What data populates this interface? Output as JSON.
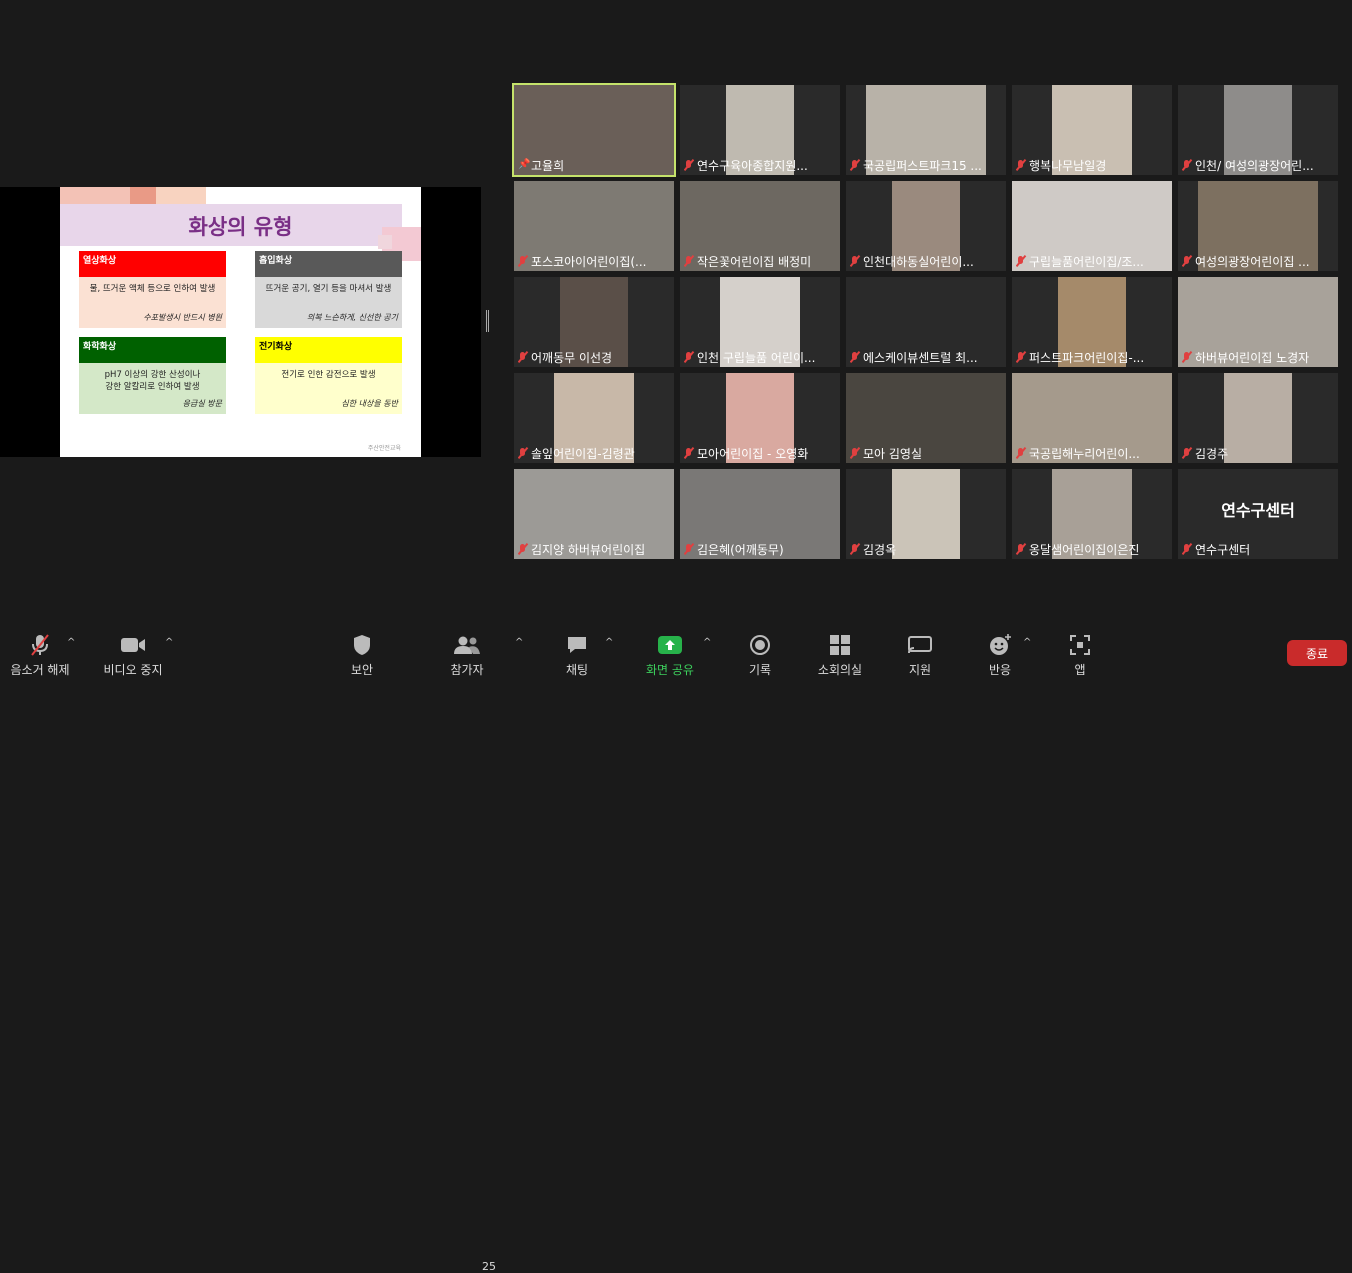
{
  "slide": {
    "title": "화상의 유형",
    "boxes": [
      {
        "header": "열상화상",
        "line1": "물, 뜨거운 액체 등으로 인하여 발생",
        "line2": "",
        "foot": "수포발생시 반드시 병원"
      },
      {
        "header": "흡입화상",
        "line1": "뜨거운 공기, 열기 등을 마셔서 발생",
        "line2": "",
        "foot": "의복 느슨하게, 신선한 공기"
      },
      {
        "header": "화학화상",
        "line1": "pH7 이상의 강한 산성이나",
        "line2": "강한 알칼리로 인하여 발생",
        "foot": "응급실 방문"
      },
      {
        "header": "전기화상",
        "line1": "전기로 인한 감전으로 발생",
        "line2": "",
        "foot": "심한 내상을 동반"
      }
    ],
    "footer": "주산안전교육"
  },
  "participants": [
    {
      "name": "고율희",
      "icon": "pin",
      "video": "#6a5f58",
      "active": true
    },
    {
      "name": "연수구육아종합지원...",
      "icon": "mic-off",
      "video": "#bfbab0"
    },
    {
      "name": "국공립퍼스트파크15 ...",
      "icon": "mic-off",
      "video": "#b8b2a8"
    },
    {
      "name": "행복나무남일경",
      "icon": "mic-off",
      "video": "#c9bfb2"
    },
    {
      "name": "인천/ 여성의광장어린...",
      "icon": "mic-off",
      "video": "#8e8c8a"
    },
    {
      "name": "포스코아이어린이집(...",
      "icon": "mic-off",
      "video": "#7e7a73"
    },
    {
      "name": "작은꽃어린이집 배정미",
      "icon": "mic-off",
      "video": "#6d6861"
    },
    {
      "name": "인천대하동실어린이...",
      "icon": "mic-off",
      "video": "#9a8a7e"
    },
    {
      "name": "구립늘품어린이집/조...",
      "icon": "mic-off",
      "video": "#cfcac6"
    },
    {
      "name": "여성의광장어린이집 ...",
      "icon": "mic-off",
      "video": "#7d7060"
    },
    {
      "name": "어깨동무 이선경",
      "icon": "mic-off",
      "video": "#5a4f48"
    },
    {
      "name": "인천 구립늘품 어린이...",
      "icon": "mic-off",
      "video": "#d5d0cb"
    },
    {
      "name": "에스케이뷰센트럴 최...",
      "icon": "mic-off",
      "video": "#2a2a2a"
    },
    {
      "name": "퍼스트파크어린이집-...",
      "icon": "mic-off",
      "video": "#a58a6a"
    },
    {
      "name": "하버뷰어린이집 노경자",
      "icon": "mic-off",
      "video": "#a8a29a"
    },
    {
      "name": "솔잎어린이집-김령관",
      "icon": "mic-off",
      "video": "#c8b8a8"
    },
    {
      "name": "모아어린이집 - 오영화",
      "icon": "mic-off",
      "video": "#d9a9a0"
    },
    {
      "name": "모아 김영실",
      "icon": "mic-off",
      "video": "#4a4640"
    },
    {
      "name": "국공립해누리어린이...",
      "icon": "mic-off",
      "video": "#a59a8c"
    },
    {
      "name": "김경주",
      "icon": "mic-off",
      "video": "#b8aea4"
    },
    {
      "name": "김지양 하버뷰어린이집",
      "icon": "mic-off",
      "video": "#9c9a96"
    },
    {
      "name": "김은혜(어깨동무)",
      "icon": "mic-off",
      "video": "#7a7876"
    },
    {
      "name": "김경옥",
      "icon": "mic-off",
      "video": "#cbc4b8"
    },
    {
      "name": "옹달샘어린이집이은진",
      "icon": "mic-off",
      "video": "#a8a097"
    },
    {
      "name": "연수구센터",
      "icon": "mic-off",
      "video": "",
      "center_text": "연수구센터"
    }
  ],
  "toolbar": {
    "unmute": "음소거 해제",
    "stop_video": "비디오 중지",
    "security": "보안",
    "participants": "참가자",
    "participant_count": "25",
    "chat": "채팅",
    "share_screen": "화면 공유",
    "record": "기록",
    "breakout": "소회의실",
    "support": "지원",
    "reactions": "반응",
    "apps": "앱",
    "end": "종료"
  },
  "colors": {
    "share_green": "#27b24a",
    "end_red": "#c92b2b",
    "active_speaker": "#c5e36b"
  }
}
